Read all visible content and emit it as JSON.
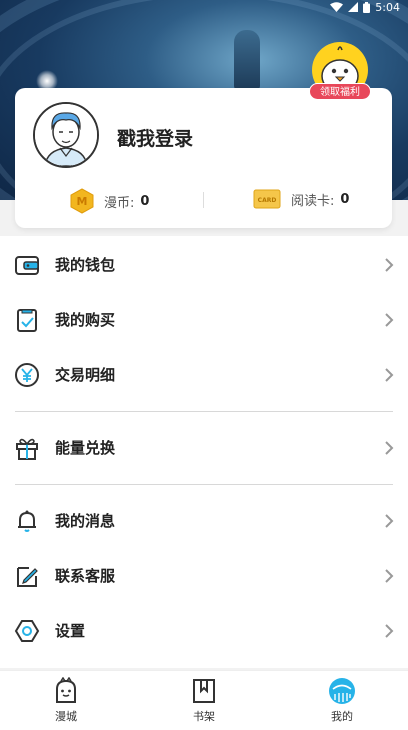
{
  "status_bar": {
    "time": "5:04"
  },
  "profile": {
    "login_text": "戳我登录",
    "welfare_badge": "领取福利",
    "coins_label": "漫币:",
    "coins_value": "0",
    "card_label": "阅读卡:",
    "card_value": "0",
    "card_icon_text": "CARD",
    "coin_icon_text": "M"
  },
  "menu": {
    "items": [
      {
        "label": "我的钱包",
        "icon": "wallet-icon"
      },
      {
        "label": "我的购买",
        "icon": "purchase-check-icon"
      },
      {
        "label": "交易明细",
        "icon": "yen-icon"
      },
      {
        "label": "能量兑换",
        "icon": "gift-icon"
      },
      {
        "label": "我的消息",
        "icon": "bell-icon"
      },
      {
        "label": "联系客服",
        "icon": "edit-note-icon"
      },
      {
        "label": "设置",
        "icon": "hexagon-settings-icon"
      }
    ]
  },
  "tabbar": {
    "tabs": [
      {
        "label": "漫城",
        "icon": "mascot-face-icon"
      },
      {
        "label": "书架",
        "icon": "bookmark-book-icon"
      },
      {
        "label": "我的",
        "icon": "profile-circle-icon"
      }
    ],
    "active_color": "#27b3e8"
  },
  "colors": {
    "accent": "#27b3e8",
    "badge": "#e8475a",
    "coin": "#f2b61f"
  }
}
